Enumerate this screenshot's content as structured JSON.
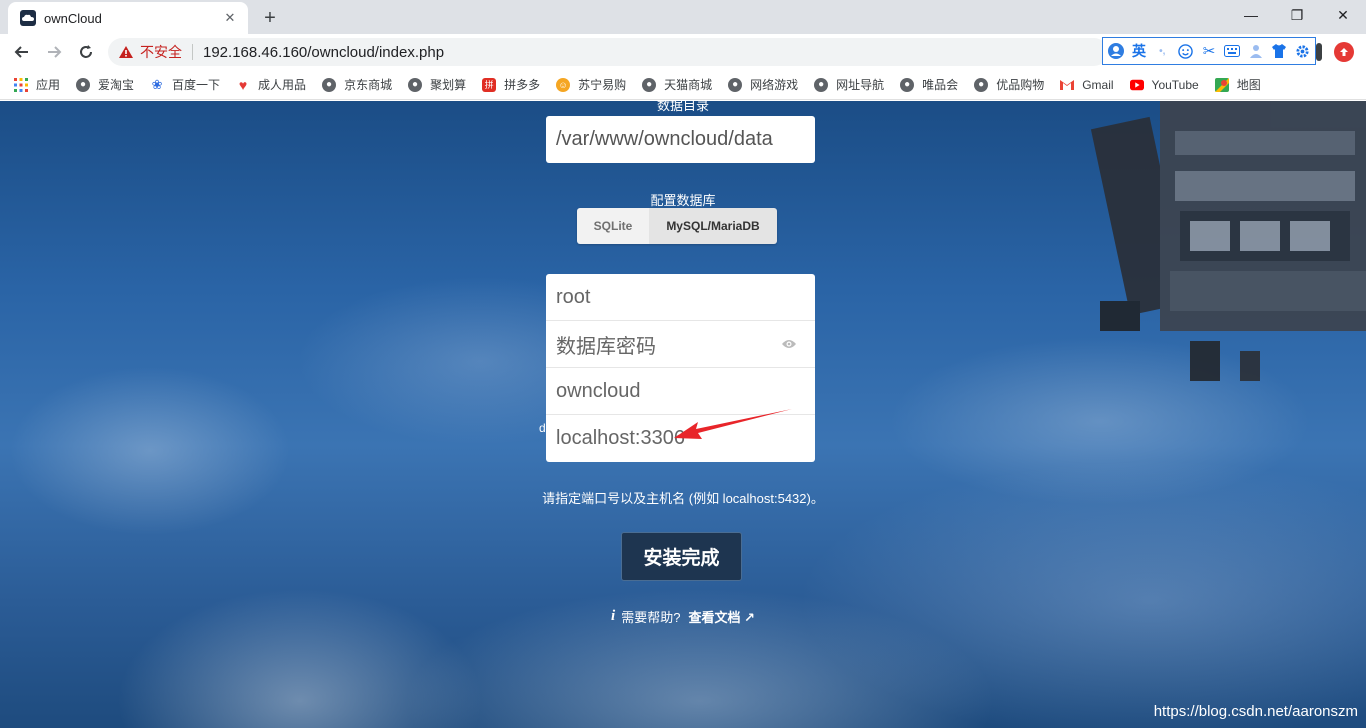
{
  "browser": {
    "tab_title": "ownCloud",
    "tab_close": "✕",
    "new_tab": "+",
    "minimize": "—",
    "restore": "❐",
    "close": "✕",
    "insecure_label": "不安全",
    "url": "192.168.46.160/owncloud/index.php",
    "ime_label": "英",
    "bookmarks": [
      {
        "label": "应用",
        "icon": "apps-grid-icon"
      },
      {
        "label": "爱淘宝",
        "icon": "globe-icon"
      },
      {
        "label": "百度一下",
        "icon": "baidu-paw-icon"
      },
      {
        "label": "成人用品",
        "icon": "heart-icon"
      },
      {
        "label": "京东商城",
        "icon": "globe-icon"
      },
      {
        "label": "聚划算",
        "icon": "globe-icon"
      },
      {
        "label": "拼多多",
        "icon": "pinduoduo-icon"
      },
      {
        "label": "苏宁易购",
        "icon": "suning-icon"
      },
      {
        "label": "天猫商城",
        "icon": "globe-icon"
      },
      {
        "label": "网络游戏",
        "icon": "globe-icon"
      },
      {
        "label": "网址导航",
        "icon": "globe-icon"
      },
      {
        "label": "唯品会",
        "icon": "globe-icon"
      },
      {
        "label": "优品购物",
        "icon": "globe-icon"
      },
      {
        "label": "Gmail",
        "icon": "gmail-icon"
      },
      {
        "label": "YouTube",
        "icon": "youtube-icon"
      },
      {
        "label": "地图",
        "icon": "maps-icon"
      }
    ]
  },
  "setup": {
    "data_dir_label": "数据目录",
    "data_dir_value": "/var/www/owncloud/data",
    "db_label": "配置数据库",
    "db_options": [
      "SQLite",
      "MySQL/MariaDB"
    ],
    "db_user": "root",
    "db_password_placeholder": "数据库密码",
    "db_name": "owncloud",
    "db_host": "localhost:3306",
    "cropped_char": "d",
    "host_hint": "请指定端口号以及主机名 (例如 localhost:5432)。",
    "install_button": "安装完成",
    "help_icon": "i",
    "help_text": "需要帮助?",
    "help_link": "查看文档 ↗"
  },
  "watermark": "https://blog.csdn.net/aaronszm",
  "colors": {
    "accent_red": "#e53935",
    "install_button_bg": "#1e3550"
  }
}
